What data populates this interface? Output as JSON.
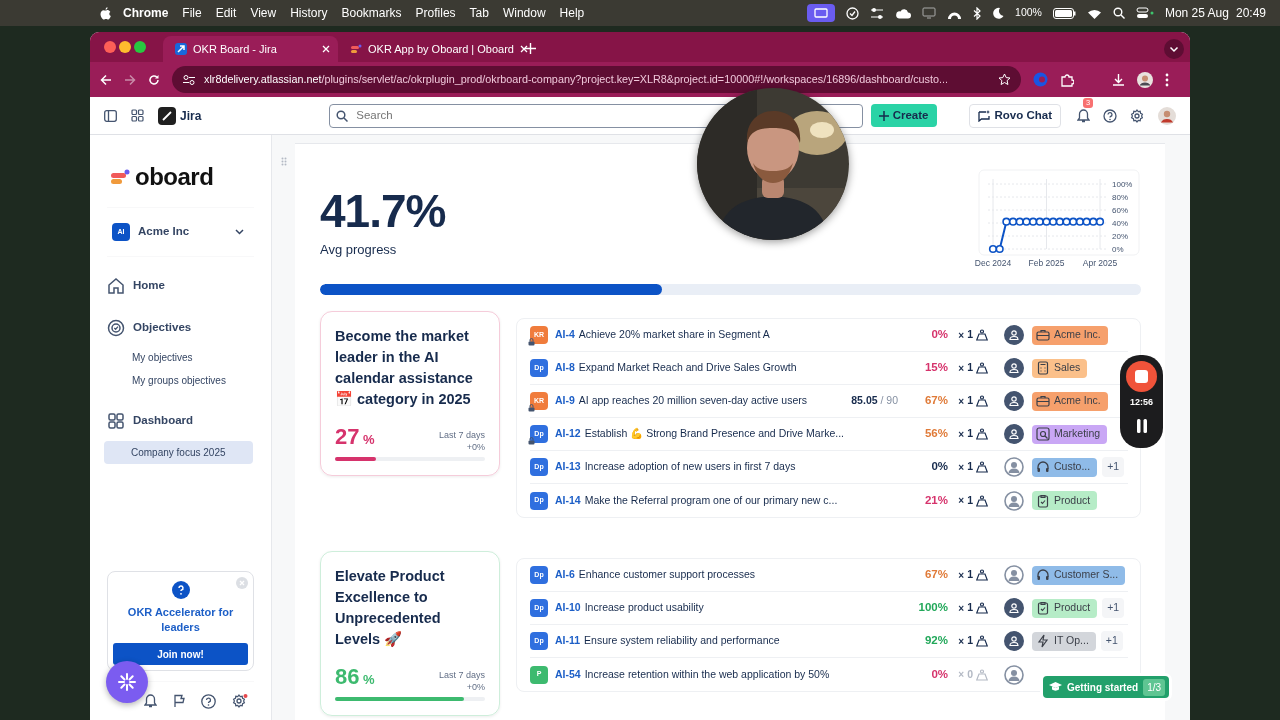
{
  "menubar": {
    "app": "Chrome",
    "menus": [
      "File",
      "Edit",
      "View",
      "History",
      "Bookmarks",
      "Profiles",
      "Tab",
      "Window",
      "Help"
    ],
    "battery": "100%",
    "date": "Mon 25 Aug",
    "time": "20:49"
  },
  "browser": {
    "tabs": [
      {
        "title": "OKR Board - Jira",
        "selected": true
      },
      {
        "title": "OKR App by Oboard | Oboard",
        "selected": false
      }
    ],
    "url_host": "xlr8delivery.atlassian.net",
    "url_path": "/plugins/servlet/ac/okrplugin_prod/okrboard-company?project.key=XLR8&project.id=10000#!/workspaces/16896/dashboard/custo..."
  },
  "jira_header": {
    "product": "Jira",
    "search_placeholder": "Search",
    "create": "Create",
    "rovo": "Rovo Chat",
    "notifications": "3"
  },
  "sidebar": {
    "logo": "oboard",
    "workspace": {
      "initials": "AI",
      "name": "Acme Inc"
    },
    "items": [
      {
        "label": "Home",
        "kind": "home"
      },
      {
        "label": "Objectives",
        "kind": "objectives",
        "children": [
          {
            "label": "My objectives",
            "selected": false
          },
          {
            "label": "My groups objectives",
            "selected": false
          }
        ]
      },
      {
        "label": "Dashboard",
        "kind": "dashboard",
        "children": [
          {
            "label": "Company focus 2025",
            "selected": true
          }
        ]
      }
    ],
    "promo": {
      "title": "OKR Accelerator for leaders",
      "button": "Join now!"
    }
  },
  "dashboard": {
    "avg": "41.7%",
    "avg_label": "Avg progress",
    "level": 0.417,
    "chart_data": {
      "type": "line",
      "categories": [
        "Dec 2024",
        null,
        null,
        null,
        null,
        null,
        null,
        null,
        "Feb 2025",
        null,
        null,
        null,
        null,
        null,
        null,
        null,
        "Apr 2025"
      ],
      "ylim": [
        0,
        100
      ],
      "yticks": [
        {
          "value": 0,
          "label": "0%"
        },
        {
          "value": 20,
          "label": "20%"
        },
        {
          "value": 40,
          "label": "40%"
        },
        {
          "value": 60,
          "label": "60%"
        },
        {
          "value": 80,
          "label": "80%"
        },
        {
          "value": 100,
          "label": "100%"
        }
      ],
      "grid": true,
      "series": [
        {
          "color": "#0c53c6",
          "marker": "o",
          "values": [
            0,
            0,
            42,
            42,
            42,
            42,
            42,
            42,
            42,
            42,
            42,
            42,
            42,
            42,
            42,
            42,
            42
          ]
        }
      ]
    },
    "objectives": [
      {
        "title": "Become the market leader in the AI calendar assistance 📅 category in 2025",
        "progress": "27",
        "unit": "%",
        "period": "Last 7 days",
        "change": "+0%",
        "level": 0.27,
        "color": "#d6336c",
        "rows": [
          {
            "badge": {
              "text": "KR",
              "color": "#f07c3c"
            },
            "locked": true,
            "key": "AI-4",
            "title": "Achieve 20% market share in Segment A",
            "progress": {
              "text": "0%",
              "color": "#d6336c"
            },
            "weight": {
              "sign": "×",
              "value": "1",
              "muted": false
            },
            "owner_assigned": true,
            "tag": {
              "text": "Acme Inc.",
              "color": "#f6a06c",
              "kind": "briefcase"
            }
          },
          {
            "badge": {
              "text": "Dp",
              "color": "#2f6fdf"
            },
            "locked": false,
            "key": "AI-8",
            "title": "Expand Market Reach and Drive Sales Growth",
            "progress": {
              "text": "15%",
              "color": "#d6336c"
            },
            "weight": {
              "sign": "×",
              "value": "1",
              "muted": false
            },
            "owner_assigned": true,
            "tag": {
              "text": "Sales",
              "color": "#fbc08a",
              "kind": "calculator"
            }
          },
          {
            "badge": {
              "text": "KR",
              "color": "#f07c3c"
            },
            "locked": true,
            "key": "AI-9",
            "title": "AI app reaches 20 million seven-day active users",
            "target": {
              "current": "85.05",
              "total": "/ 90"
            },
            "progress": {
              "text": "67%",
              "color": "#e07b39"
            },
            "weight": {
              "sign": "×",
              "value": "1",
              "muted": false
            },
            "owner_assigned": true,
            "tag": {
              "text": "Acme Inc.",
              "color": "#f6a06c",
              "kind": "briefcase"
            }
          },
          {
            "badge": {
              "text": "Dp",
              "color": "#2f6fdf"
            },
            "locked": true,
            "key": "AI-12",
            "title": "Establish 💪 Strong Brand Presence and Drive Marke...",
            "progress": {
              "text": "56%",
              "color": "#e07b39"
            },
            "weight": {
              "sign": "×",
              "value": "1",
              "muted": false
            },
            "owner_assigned": true,
            "tag": {
              "text": "Marketing",
              "color": "#c9a7f5",
              "kind": "search"
            }
          },
          {
            "badge": {
              "text": "Dp",
              "color": "#2f6fdf"
            },
            "locked": false,
            "key": "AI-13",
            "title": "Increase adoption of new users in first 7 days",
            "progress": {
              "text": "0%",
              "color": "#172b4d"
            },
            "weight": {
              "sign": "×",
              "value": "1",
              "muted": false
            },
            "owner_assigned": false,
            "tag": {
              "text": "Custo...",
              "color": "#8fbbe8",
              "kind": "headset"
            },
            "extra": "+1"
          },
          {
            "badge": {
              "text": "Dp",
              "color": "#2f6fdf"
            },
            "locked": false,
            "key": "AI-14",
            "title": "Make the Referral program one of our primary new c...",
            "progress": {
              "text": "21%",
              "color": "#d6336c"
            },
            "weight": {
              "sign": "×",
              "value": "1",
              "muted": false
            },
            "owner_assigned": false,
            "tag": {
              "text": "Product",
              "color": "#b6ecc7",
              "kind": "clipboard"
            }
          }
        ]
      },
      {
        "title": "Elevate Product Excellence to Unprecedented Levels 🚀",
        "progress": "86",
        "unit": "%",
        "period": "Last 7 days",
        "change": "+0%",
        "level": 0.86,
        "color": "#3dba6f",
        "rows": [
          {
            "badge": {
              "text": "Dp",
              "color": "#2f6fdf"
            },
            "locked": false,
            "key": "AI-6",
            "title": "Enhance customer support processes",
            "progress": {
              "text": "67%",
              "color": "#e07b39"
            },
            "weight": {
              "sign": "×",
              "value": "1",
              "muted": false
            },
            "owner_assigned": false,
            "tag": {
              "text": "Customer S...",
              "color": "#8fbbe8",
              "kind": "headset"
            }
          },
          {
            "badge": {
              "text": "Dp",
              "color": "#2f6fdf"
            },
            "locked": false,
            "key": "AI-10",
            "title": "Increase product usability",
            "progress": {
              "text": "100%",
              "color": "#22a85a"
            },
            "weight": {
              "sign": "×",
              "value": "1",
              "muted": false
            },
            "owner_assigned": true,
            "tag": {
              "text": "Product",
              "color": "#b6ecc7",
              "kind": "clipboard"
            },
            "extra": "+1"
          },
          {
            "badge": {
              "text": "Dp",
              "color": "#2f6fdf"
            },
            "locked": false,
            "key": "AI-11",
            "title": "Ensure system reliability and performance",
            "progress": {
              "text": "92%",
              "color": "#22a85a"
            },
            "weight": {
              "sign": "×",
              "value": "1",
              "muted": false
            },
            "owner_assigned": true,
            "tag": {
              "text": "IT Op...",
              "color": "#d3d6db",
              "kind": "bolt"
            },
            "extra": "+1"
          },
          {
            "badge": {
              "text": "P",
              "color": "#3dba6f"
            },
            "locked": false,
            "key": "AI-54",
            "title": "Increase retention within the web application by 50%",
            "progress": {
              "text": "0%",
              "color": "#d6336c"
            },
            "weight": {
              "sign": "×",
              "value": "0",
              "muted": true
            },
            "owner_assigned": false
          }
        ]
      }
    ]
  },
  "recorder": {
    "time": "12:56"
  },
  "getting_started": {
    "label": "Getting started",
    "step": "1/3"
  }
}
